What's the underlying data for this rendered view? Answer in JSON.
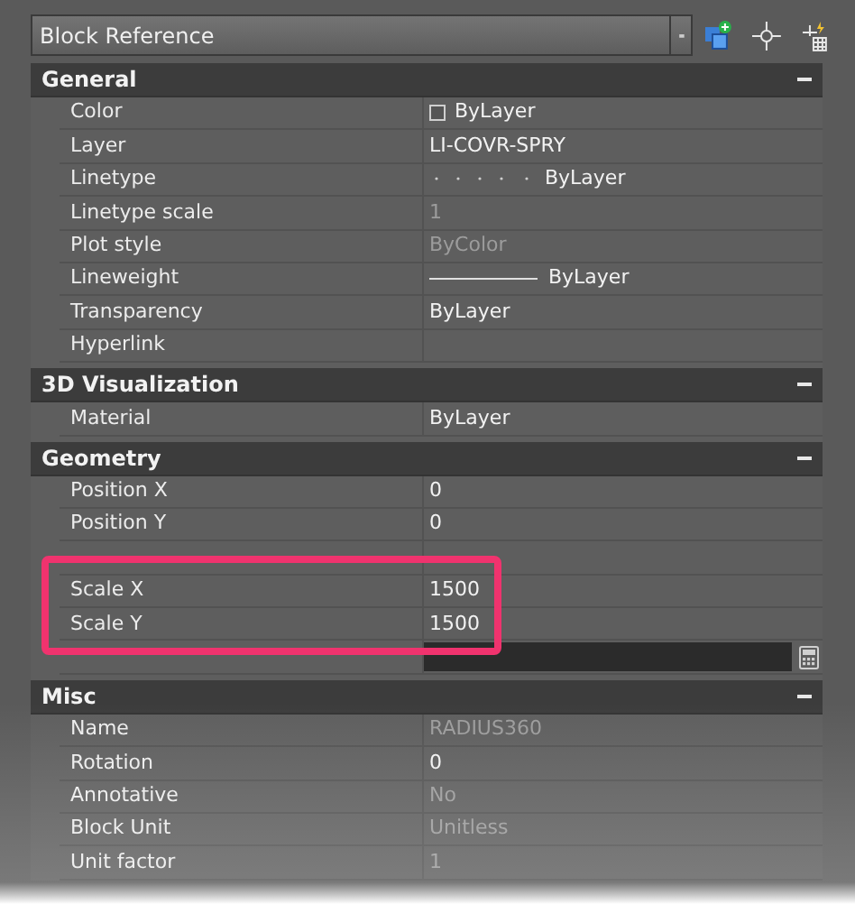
{
  "selector": {
    "value": "Block Reference"
  },
  "sections": [
    {
      "title": "General",
      "expanded": true,
      "rows": [
        {
          "label": "Color",
          "value": "ByLayer",
          "kind": "color",
          "disabled": false
        },
        {
          "label": "Layer",
          "value": "LI-COVR-SPRY",
          "kind": "text",
          "disabled": false
        },
        {
          "label": "Linetype",
          "value": "ByLayer",
          "kind": "linetype",
          "disabled": false
        },
        {
          "label": "Linetype scale",
          "value": "1",
          "kind": "text",
          "disabled": true
        },
        {
          "label": "Plot style",
          "value": "ByColor",
          "kind": "text",
          "disabled": true
        },
        {
          "label": "Lineweight",
          "value": "ByLayer",
          "kind": "lineweight",
          "disabled": false
        },
        {
          "label": "Transparency",
          "value": "ByLayer",
          "kind": "text",
          "disabled": false
        },
        {
          "label": "Hyperlink",
          "kind": "text"
        }
      ]
    },
    {
      "title": "3D Visualization",
      "expanded": true,
      "rows": [
        {
          "label": "Material",
          "value": "ByLayer",
          "kind": "text",
          "disabled": false
        }
      ]
    },
    {
      "title": "Geometry",
      "expanded": true,
      "rows": [
        {
          "label": "Position X",
          "value": "0",
          "kind": "text",
          "disabled": false
        },
        {
          "label": "Position Y",
          "value": "0",
          "kind": "text",
          "disabled": false
        },
        {
          "kind": "blank"
        },
        {
          "label": "Scale X",
          "value": "1500",
          "kind": "text",
          "disabled": false
        },
        {
          "label": "Scale Y",
          "value": "1500",
          "kind": "text",
          "disabled": false
        },
        {
          "kind": "edit"
        }
      ]
    },
    {
      "title": "Misc",
      "expanded": true,
      "rows": [
        {
          "label": "Name",
          "value": "RADIUS360",
          "kind": "text",
          "disabled": true
        },
        {
          "label": "Rotation",
          "value": "0",
          "kind": "text",
          "disabled": false
        },
        {
          "label": "Annotative",
          "value": "No",
          "kind": "text",
          "disabled": true
        },
        {
          "label": "Block Unit",
          "value": "Unitless",
          "kind": "text",
          "disabled": true
        },
        {
          "label": "Unit factor",
          "value": "1",
          "kind": "text",
          "disabled": true
        }
      ]
    }
  ]
}
